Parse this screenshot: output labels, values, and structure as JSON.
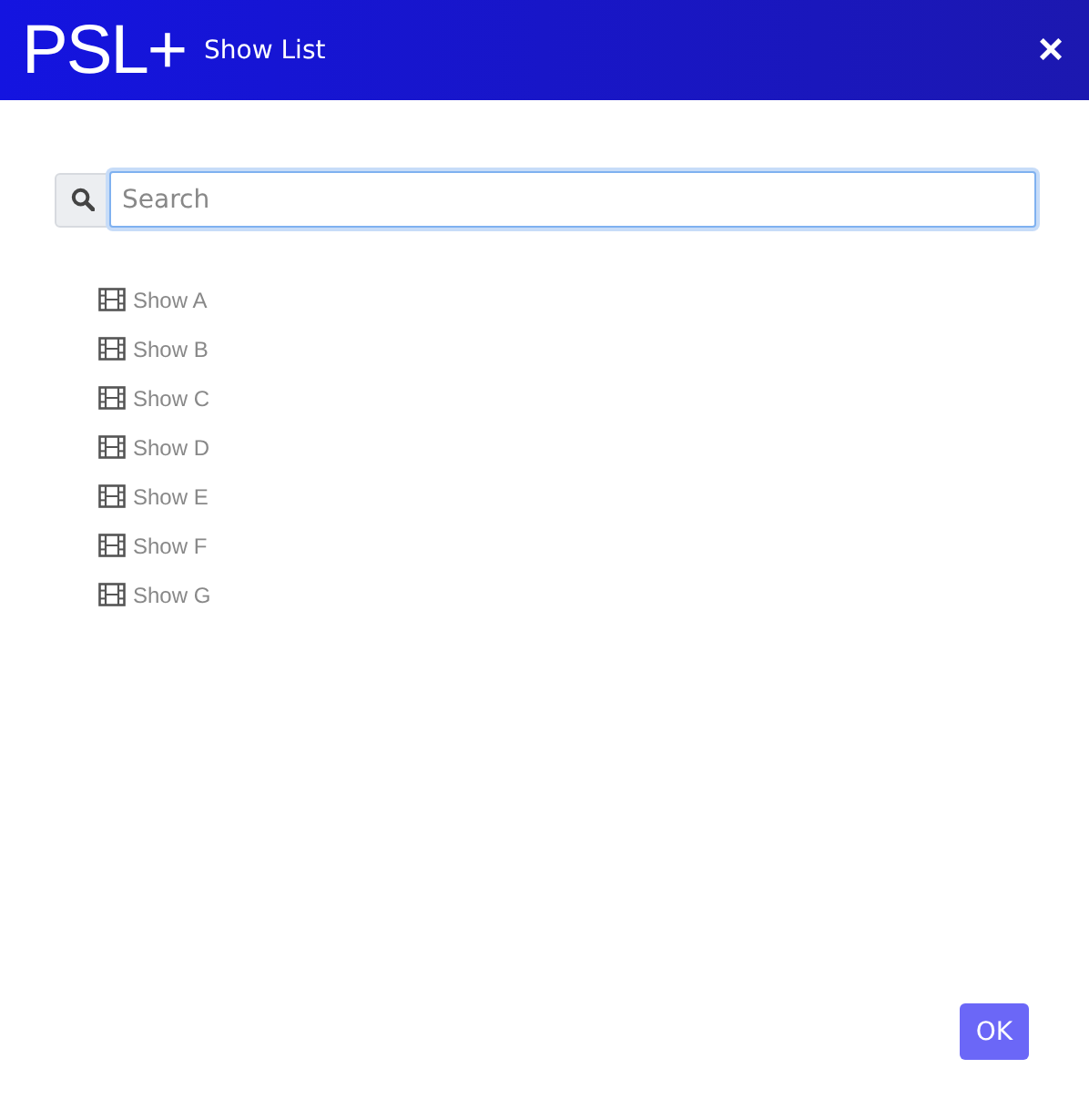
{
  "header": {
    "logo": "PSL+",
    "title": "Show List",
    "close": "×"
  },
  "search": {
    "placeholder": "Search"
  },
  "shows": [
    {
      "label": "Show A"
    },
    {
      "label": "Show B"
    },
    {
      "label": "Show C"
    },
    {
      "label": "Show D"
    },
    {
      "label": "Show E"
    },
    {
      "label": "Show F"
    },
    {
      "label": "Show G"
    }
  ],
  "buttons": [
    "OK"
  ]
}
